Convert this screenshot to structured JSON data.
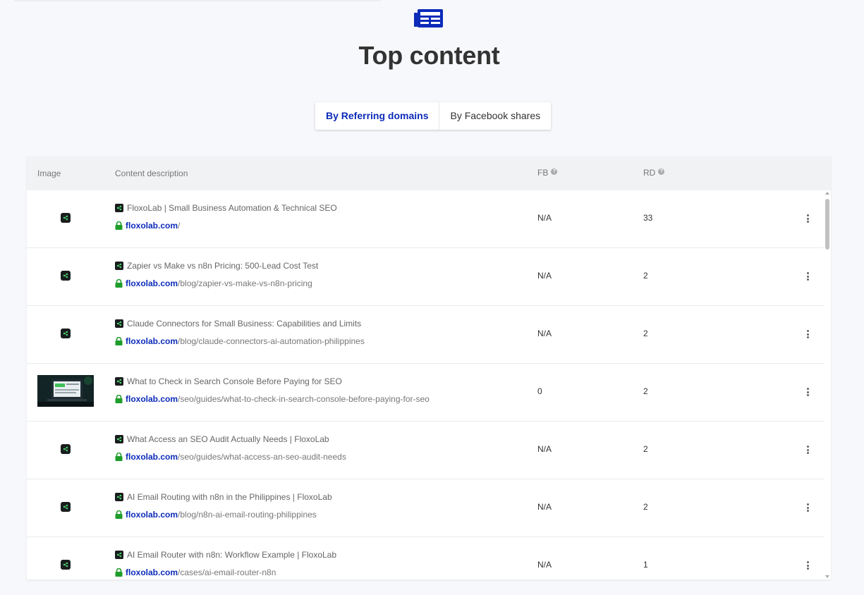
{
  "page": {
    "title": "Top content",
    "header_icon": "newspaper-icon",
    "accent_color": "#0c2bb9",
    "lock_color": "#1f9d2b"
  },
  "tabs": [
    {
      "label": "By Referring domains",
      "active": true
    },
    {
      "label": "By Facebook shares",
      "active": false
    }
  ],
  "table": {
    "headers": {
      "image": "Image",
      "description": "Content description",
      "fb": "FB",
      "rd": "RD"
    },
    "rows": [
      {
        "image": "favicon",
        "title": "FloxoLab | Small Business Automation & Technical SEO",
        "domain": "floxolab.com",
        "path": "/",
        "fb": "N/A",
        "rd": "33"
      },
      {
        "image": "favicon",
        "title": "Zapier vs Make vs n8n Pricing: 500-Lead Cost Test",
        "domain": "floxolab.com",
        "path": "/blog/zapier-vs-make-vs-n8n-pricing",
        "fb": "N/A",
        "rd": "2"
      },
      {
        "image": "favicon",
        "title": "Claude Connectors for Small Business: Capabilities and Limits",
        "domain": "floxolab.com",
        "path": "/blog/claude-connectors-ai-automation-philippines",
        "fb": "N/A",
        "rd": "2"
      },
      {
        "image": "thumbnail",
        "title": "What to Check in Search Console Before Paying for SEO",
        "domain": "floxolab.com",
        "path": "/seo/guides/what-to-check-in-search-console-before-paying-for-seo",
        "fb": "0",
        "rd": "2"
      },
      {
        "image": "favicon",
        "title": "What Access an SEO Audit Actually Needs | FloxoLab",
        "domain": "floxolab.com",
        "path": "/seo/guides/what-access-an-seo-audit-needs",
        "fb": "N/A",
        "rd": "2"
      },
      {
        "image": "favicon",
        "title": "AI Email Routing with n8n in the Philippines | FloxoLab",
        "domain": "floxolab.com",
        "path": "/blog/n8n-ai-email-routing-philippines",
        "fb": "N/A",
        "rd": "2"
      },
      {
        "image": "favicon",
        "title": "AI Email Router with n8n: Workflow Example | FloxoLab",
        "domain": "floxolab.com",
        "path": "/cases/ai-email-router-n8n",
        "fb": "N/A",
        "rd": "1"
      }
    ]
  }
}
